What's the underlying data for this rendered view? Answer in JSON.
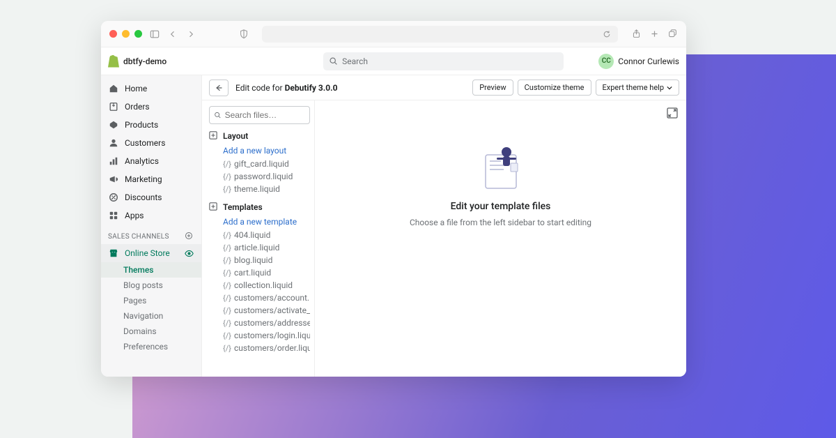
{
  "store_name": "dbtfy-demo",
  "top_search_placeholder": "Search",
  "user": {
    "initials": "CC",
    "name": "Connor Curlewis"
  },
  "nav": {
    "primary": [
      {
        "icon": "home",
        "label": "Home"
      },
      {
        "icon": "orders",
        "label": "Orders"
      },
      {
        "icon": "products",
        "label": "Products"
      },
      {
        "icon": "customers",
        "label": "Customers"
      },
      {
        "icon": "analytics",
        "label": "Analytics"
      },
      {
        "icon": "marketing",
        "label": "Marketing"
      },
      {
        "icon": "discounts",
        "label": "Discounts"
      },
      {
        "icon": "apps",
        "label": "Apps"
      }
    ],
    "sales_channels_label": "SALES CHANNELS",
    "online_store_label": "Online Store",
    "online_store_sub": [
      "Themes",
      "Blog posts",
      "Pages",
      "Navigation",
      "Domains",
      "Preferences"
    ]
  },
  "editor": {
    "title_prefix": "Edit code for ",
    "theme_name": "Debutify 3.0.0",
    "buttons": {
      "preview": "Preview",
      "customize": "Customize theme",
      "expert_help": "Expert theme help"
    },
    "search_files_placeholder": "Search files…",
    "sections": {
      "layout": {
        "label": "Layout",
        "add": "Add a new layout",
        "files": [
          "gift_card.liquid",
          "password.liquid",
          "theme.liquid"
        ]
      },
      "templates": {
        "label": "Templates",
        "add": "Add a new template",
        "files": [
          "404.liquid",
          "article.liquid",
          "blog.liquid",
          "cart.liquid",
          "collection.liquid",
          "customers/account.liquid",
          "customers/activate_account.liquid",
          "customers/addresses.liquid",
          "customers/login.liquid",
          "customers/order.liquid"
        ]
      }
    },
    "canvas": {
      "title": "Edit your template files",
      "subtitle": "Choose a file from the left sidebar to start editing"
    }
  }
}
